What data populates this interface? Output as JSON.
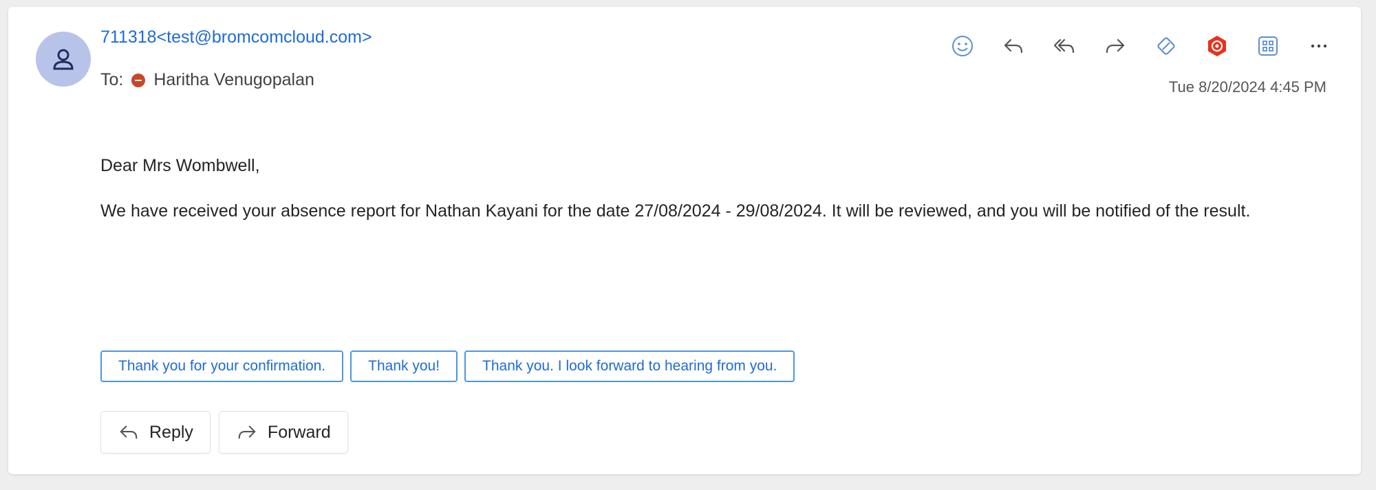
{
  "message": {
    "sender": "711318<test@bromcomcloud.com>",
    "to_label": "To:",
    "recipient": "Haritha Venugopalan",
    "date": "Tue 8/20/2024 4:45 PM",
    "greeting": "Dear Mrs Wombwell,",
    "body": "We have received your absence report for Nathan Kayani for the date 27/08/2024 - 29/08/2024. It will be reviewed, and you will be notified of the result."
  },
  "suggested_replies": [
    "Thank you for your confirmation.",
    "Thank you!",
    "Thank you. I look forward to hearing from you."
  ],
  "actions": {
    "reply_label": "Reply",
    "forward_label": "Forward"
  },
  "toolbar": {
    "icons": [
      "emoji-icon",
      "reply-icon",
      "reply-all-icon",
      "forward-icon",
      "tag-icon",
      "addin-icon",
      "apps-icon",
      "more-icon"
    ]
  },
  "colors": {
    "accent": "#1e6bd6",
    "avatar_bg": "#b8c3ea",
    "presence_busy": "#c8462b",
    "addin_red": "#e8321e"
  }
}
